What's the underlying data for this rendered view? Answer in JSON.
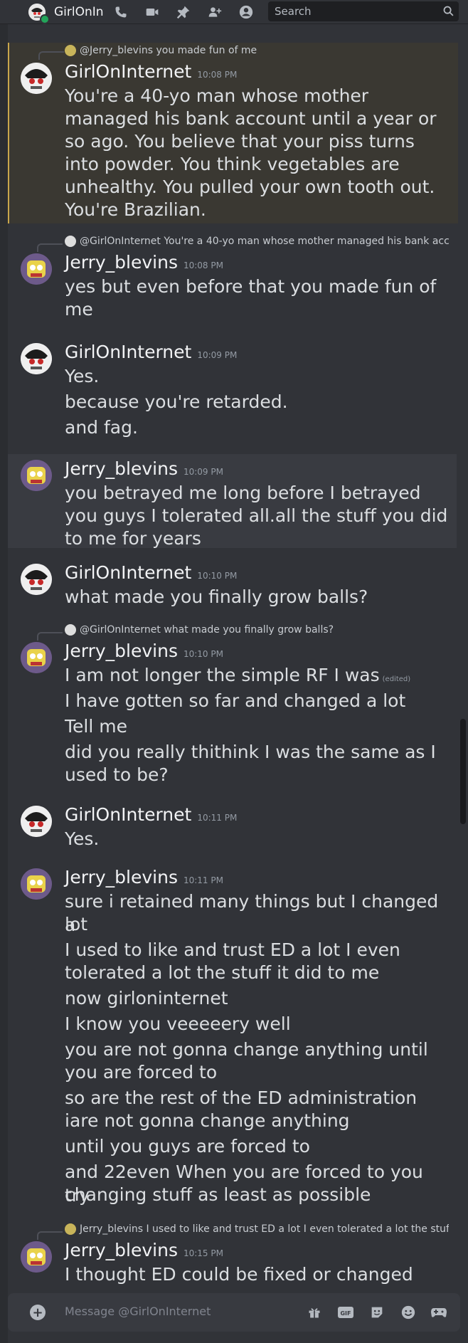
{
  "header": {
    "dm_name": "GirlOnInternet",
    "search_placeholder": "Search",
    "icons": [
      "phone-icon",
      "video-icon",
      "pin-icon",
      "add-member-icon",
      "profile-icon"
    ]
  },
  "composer": {
    "placeholder": "Message @GirlOnInternet"
  },
  "messages": [
    {
      "reply": "@Jerry_blevins you made fun of me",
      "author": "GirlOnInternet",
      "time": "10:08 PM",
      "lines": [
        "You're a 40-yo man whose mother",
        "managed his bank account until a year or",
        "so ago. You believe that your piss turns",
        "into powder. You think vegetables are",
        "unhealthy. You pulled your own tooth out.",
        "You're Brazilian."
      ]
    },
    {
      "reply": "@GirlOnInternet You're a 40-yo man whose mother managed his bank acc...",
      "author": "Jerry_blevins",
      "time": "10:08 PM",
      "lines": [
        "yes but even before that you made fun of",
        "me"
      ]
    },
    {
      "author": "GirlOnInternet",
      "time": "10:09 PM",
      "lines": [
        "Yes.",
        "because you're retarded.",
        "and fag."
      ]
    },
    {
      "author": "Jerry_blevins",
      "time": "10:09 PM",
      "lines": [
        "you betrayed me long before I betrayed",
        "you guys I tolerated all.all the stuff you did",
        "to me for years"
      ]
    },
    {
      "author": "GirlOnInternet",
      "time": "10:10 PM",
      "lines": [
        "what made you finally grow balls?"
      ]
    },
    {
      "reply": "@GirlOnInternet what made you finally grow balls?",
      "author": "Jerry_blevins",
      "time": "10:10 PM",
      "lines": [
        "I am not longer the simple RF I was",
        "I have gotten so far and changed a lot",
        "Tell me",
        "did you really thithink I was the same as I",
        "used to be?"
      ],
      "edited": "(edited)"
    },
    {
      "author": "GirlOnInternet",
      "time": "10:11 PM",
      "lines": [
        "Yes."
      ]
    },
    {
      "author": "Jerry_blevins",
      "time": "10:11 PM",
      "lines": [
        "sure i retained many things but I changed a",
        "lot",
        "I used to like and trust ED a lot I even",
        "tolerated a lot the stuff it did to me",
        "now girloninternet",
        "I know you veeeeery well",
        "you are not gonna change anything until",
        "you are forced to",
        "so are the rest of the ED administration",
        "iare not gonna change anything",
        "until you guys are forced to",
        "and 22even When you are forced to you try",
        "changing stuff as least as possible"
      ]
    },
    {
      "reply": "Jerry_blevins I used to like and trust ED a lot I even tolerated a lot the stuff...",
      "author": "Jerry_blevins",
      "time": "10:15 PM",
      "lines": [
        "I thought ED could be fixed or changed"
      ]
    }
  ]
}
